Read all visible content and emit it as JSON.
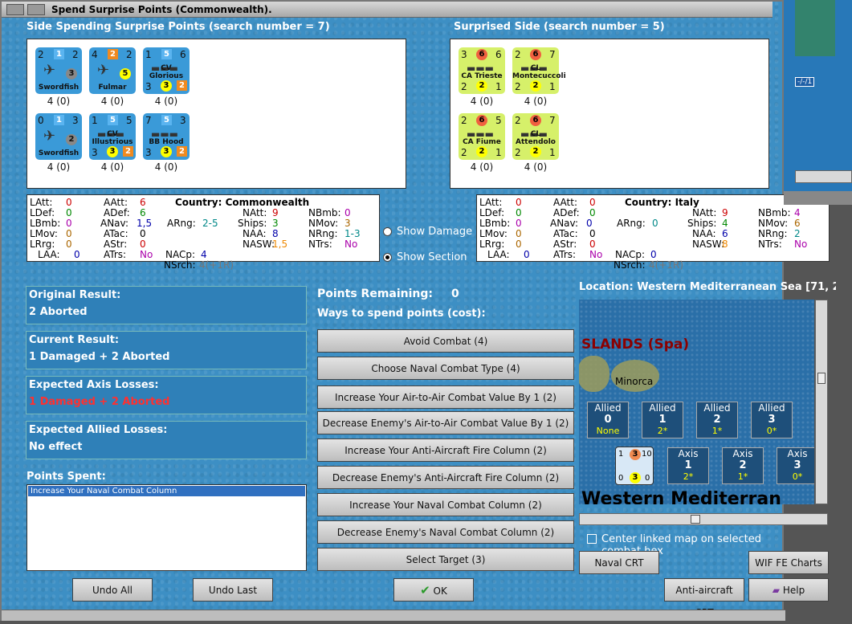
{
  "window": {
    "title": "Spend Surprise Points (Commonwealth)."
  },
  "left_side": {
    "header": "Side Spending Surprise Points (search number = 7)",
    "units": [
      {
        "name": "Swordfish",
        "a": "2",
        "b": "1",
        "c": "2",
        "bottom": "3",
        "val": "4 (0)"
      },
      {
        "name": "Fulmar",
        "a": "4",
        "b": "2",
        "c": "2",
        "bottom": "5",
        "val": "4 (0)"
      },
      {
        "name": "CV Glorious",
        "a": "1",
        "b": "5",
        "c": "6",
        "l": "3",
        "m": "3",
        "r": "2",
        "val": "4 (0)"
      },
      {
        "name": "Swordfish",
        "a": "0",
        "b": "1",
        "c": "3",
        "bottom": "2",
        "val": "4 (0)"
      },
      {
        "name": "CV Illustrious",
        "a": "1",
        "b": "5",
        "c": "5",
        "l": "3",
        "m": "3",
        "r": "2",
        "val": "4 (0)"
      },
      {
        "name": "BB Hood",
        "a": "7",
        "b": "5",
        "c": "3",
        "l": "3",
        "m": "3",
        "r": "2",
        "val": "4 (0)"
      }
    ]
  },
  "right_side": {
    "header": "Surprised Side (search number = 5)",
    "units": [
      {
        "name": "CA Trieste",
        "a": "3",
        "b": "6",
        "c": "6",
        "l": "2",
        "m": "2",
        "r": "1",
        "val": "4 (0)"
      },
      {
        "name": "CL Montecuccoli",
        "a": "2",
        "b": "6",
        "c": "7",
        "l": "2",
        "m": "2",
        "r": "1",
        "val": "4 (0)"
      },
      {
        "name": "CA Fiume",
        "a": "2",
        "b": "6",
        "c": "5",
        "l": "2",
        "m": "2",
        "r": "1",
        "val": "4 (0)"
      },
      {
        "name": "CL Attendolo",
        "a": "2",
        "b": "6",
        "c": "7",
        "l": "2",
        "m": "2",
        "r": "1",
        "val": "4 (0)"
      }
    ]
  },
  "left_stats": {
    "country": "Country: Commonwealth",
    "latt": "0",
    "ldef": "0",
    "lbmb": "0",
    "lmov": "0",
    "lrrg": "0",
    "laa": "0",
    "aatt": "6",
    "adef": "6",
    "anav": "1,5",
    "atac": "0",
    "astr": "0",
    "atrs": "No",
    "arng": "2-5",
    "nacp": "4",
    "nsrch": "4(+1R)",
    "natt": "9",
    "ships": "3",
    "naa": "8",
    "nasw": "1,5",
    "nbmb": "0",
    "nmov": "3",
    "nrng": "1-3",
    "ntrs": "No"
  },
  "right_stats": {
    "country": "Country: Italy",
    "latt": "0",
    "ldef": "0",
    "lbmb": "0",
    "lmov": "0",
    "lrrg": "0",
    "laa": "0",
    "aatt": "0",
    "adef": "0",
    "anav": "0",
    "atac": "0",
    "astr": "0",
    "atrs": "No",
    "arng": "0",
    "nacp": "0",
    "nsrch": "4(+1R)",
    "natt": "9",
    "ships": "4",
    "naa": "6",
    "nasw": "8",
    "nbmb": "4",
    "nmov": "6",
    "nrng": "2",
    "ntrs": "No"
  },
  "labels": {
    "latt": "LAtt:",
    "ldef": "LDef:",
    "lbmb": "LBmb:",
    "lmov": "LMov:",
    "lrrg": "LRrg:",
    "laa": "LAA:",
    "aatt": "AAtt:",
    "adef": "ADef:",
    "anav": "ANav:",
    "atac": "ATac:",
    "astr": "AStr:",
    "atrs": "ATrs:",
    "arng": "ARng:",
    "nacp": "NACp:",
    "nsrch": "NSrch:",
    "natt": "NAtt:",
    "ships": "Ships:",
    "naa": "NAA:",
    "nasw": "NASW:",
    "nbmb": "NBmb:",
    "nmov": "NMov:",
    "nrng": "NRng:",
    "ntrs": "NTrs:"
  },
  "options": {
    "show_damage": "Show Damage",
    "show_section": "Show Section"
  },
  "results": {
    "original_label": "Original Result:",
    "original": "2 Aborted",
    "current_label": "Current Result:",
    "current": "1 Damaged + 2 Aborted",
    "axis_label": "Expected Axis Losses:",
    "axis": "1 Damaged + 2 Aborted",
    "allied_label": "Expected Allied Losses:",
    "allied": "No effect"
  },
  "points_spent": {
    "label": "Points Spent:",
    "items": [
      "Increase Your Naval Combat Column"
    ]
  },
  "spend": {
    "remaining_label": "Points Remaining:",
    "remaining": "0",
    "ways_label": "Ways to spend points (cost):",
    "options": [
      "Avoid Combat (4)",
      "Choose Naval Combat Type (4)",
      "Increase Your Air-to-Air Combat Value By 1 (2)",
      "Decrease Enemy's Air-to-Air Combat Value By 1 (2)",
      "Increase Your Anti-Aircraft Fire Column (2)",
      "Decrease Enemy's Anti-Aircraft Fire Column (2)",
      "Increase Your Naval Combat Column (2)",
      "Decrease Enemy's Naval Combat Column (2)",
      "Select Target (3)"
    ]
  },
  "location": {
    "label": "Location: Western Mediterranean Sea [71, 2",
    "map_title": "SLANDS (Spa)",
    "island": "Minorca",
    "sea_label": "Western Mediterran",
    "allied": [
      {
        "t": "Allied",
        "n": "0",
        "s": "None"
      },
      {
        "t": "Allied",
        "n": "1",
        "s": "2*"
      },
      {
        "t": "Allied",
        "n": "2",
        "s": "1*"
      },
      {
        "t": "Allied",
        "n": "3",
        "s": "0*"
      }
    ],
    "axis": [
      {
        "t": "Axis",
        "n": "1",
        "s": "2*"
      },
      {
        "t": "Axis",
        "n": "2",
        "s": "1*"
      },
      {
        "t": "Axis",
        "n": "3",
        "s": "0*"
      }
    ],
    "stack": {
      "a": "1",
      "b": "3",
      "c": "10",
      "d": "0",
      "e": "3",
      "f": "0"
    },
    "center_label": "Center linked map on selected combat hex"
  },
  "buttons": {
    "undo_all": "Undo All",
    "undo_last": "Undo Last",
    "ok": "OK",
    "naval_crt": "Naval CRT",
    "wif_charts": "WIF FE Charts",
    "aa_crt": "Anti-aircraft CRT",
    "help": "Help"
  },
  "side_map": {
    "label": "-/-/1"
  }
}
